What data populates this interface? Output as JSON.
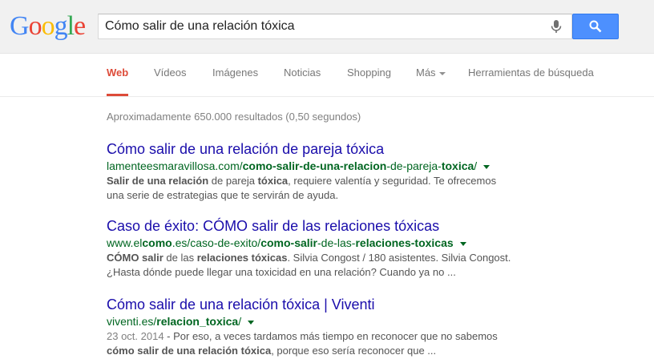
{
  "logo": {
    "letters": [
      "G",
      "o",
      "o",
      "g",
      "l",
      "e"
    ],
    "colors": [
      "#4285f4",
      "#ea4335",
      "#fbbc05",
      "#4285f4",
      "#34a853",
      "#ea4335"
    ]
  },
  "search": {
    "query": "Cómo salir de una relación tóxica",
    "mic_icon": "microphone-icon",
    "button_icon": "magnifier-icon",
    "button_color": "#4d90fe"
  },
  "tabs": {
    "web": "Web",
    "videos": "Vídeos",
    "images": "Imágenes",
    "news": "Noticias",
    "shopping": "Shopping",
    "more": "Más",
    "tools": "Herramientas de búsqueda"
  },
  "stats": "Aproximadamente 650.000 resultados (0,50 segundos)",
  "results": [
    {
      "title": "Cómo salir de una relación de pareja tóxica",
      "url": [
        "lamenteesmaravillosa.com/",
        "como-salir-de-una-relacion",
        "-de-pareja-",
        "toxica",
        "/"
      ],
      "snippet": [
        "Salir de una relación",
        " de pareja ",
        "tóxica",
        ", requiere valentía y seguridad. Te ofrecemos",
        "una serie de estrategias que te servirán de ayuda."
      ]
    },
    {
      "title": "Caso de éxito: CÓMO salir de las relaciones tóxicas",
      "url": [
        "www.el",
        "como",
        ".es/caso-de-exito/",
        "como-salir",
        "-de-las-",
        "relaciones-toxicas"
      ],
      "snippet": [
        "CÓMO salir",
        " de las ",
        "relaciones tóxicas",
        ". Silvia Congost / 180 asistentes. Silvia Congost.",
        "¿Hasta dónde puede llegar una toxicidad en una relación? Cuando ya no ..."
      ]
    },
    {
      "title": "Cómo salir de una relación tóxica | Viventi",
      "url": [
        "viventi.es/",
        "relacion_toxica",
        "/"
      ],
      "date": "23 oct. 2014",
      "snippet": [
        " - Por eso, a veces tardamos más tiempo en reconocer que no sabemos",
        "cómo salir de una relación tóxica",
        ", porque eso sería reconocer que ..."
      ]
    }
  ]
}
